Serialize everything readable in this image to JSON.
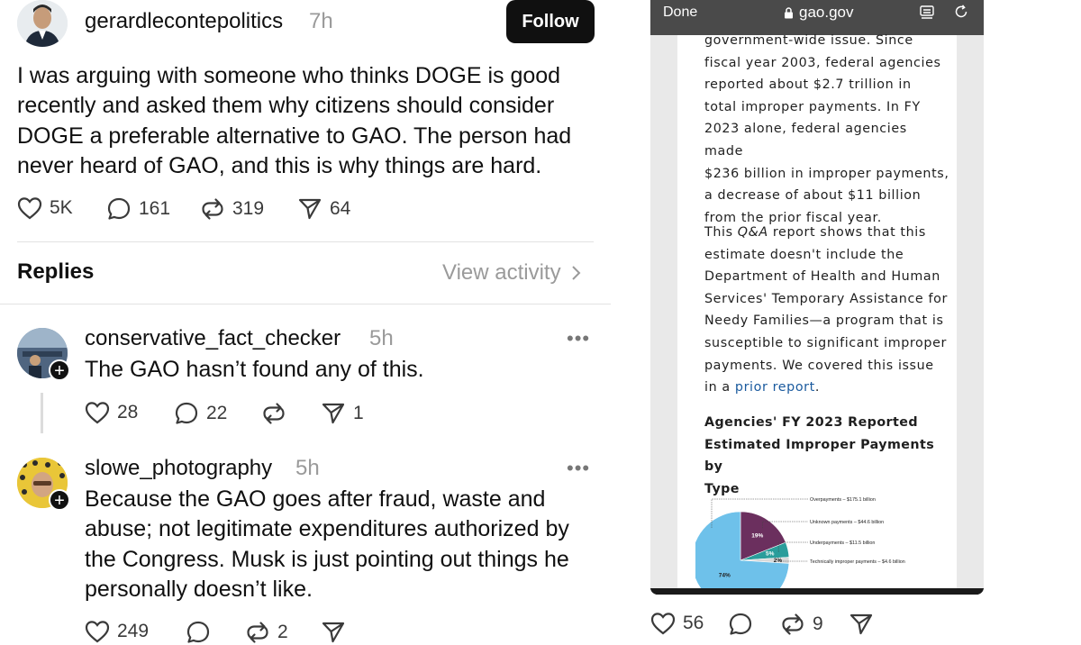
{
  "post": {
    "username": "gerardlecontepolitics",
    "time": "7h",
    "follow_label": "Follow",
    "text_lines": [
      "I was arguing with someone who thinks DOGE is good",
      "recently and asked them why citizens should consider",
      "DOGE a preferable alternative to GAO. The person had",
      "never heard of GAO, and this is why things are hard."
    ],
    "likes": "5K",
    "comments": "161",
    "reposts": "319",
    "shares": "64"
  },
  "replies_header": {
    "title": "Replies",
    "view_activity": "View activity"
  },
  "replies": [
    {
      "username": "conservative_fact_checker",
      "time": "5h",
      "more": "•••",
      "text_lines": [
        "The GAO hasn’t found any of this."
      ],
      "likes": "28",
      "comments": "22",
      "reposts": "",
      "shares": "1"
    },
    {
      "username": "slowe_photography",
      "time": "5h",
      "more": "•••",
      "text_lines": [
        "Because the GAO goes after fraud, waste and",
        "abuse; not legitimate expenditures authorized by",
        "the Congress.  Musk is just pointing out things he",
        "personally doesn’t like."
      ],
      "likes": "249",
      "comments": "",
      "reposts": "2",
      "shares": ""
    }
  ],
  "embedded_screenshot": {
    "done_label": "Done",
    "url": "gao.gov",
    "para1_lines": [
      "government-wide issue. Since",
      "fiscal year 2003, federal agencies",
      "reported about $2.7 trillion in",
      "total improper payments. In FY",
      "2023 alone, federal agencies made",
      "$236 billion in improper payments,",
      "a decrease of about $11 billion",
      "from the prior fiscal year."
    ],
    "para2_line1_prefix": "This ",
    "para2_line1_italic": "Q&A",
    "para2_line1_suffix": " report shows that this",
    "para2_lines": [
      "estimate doesn't include the",
      "Department of Health and Human",
      "Services' Temporary Assistance for",
      "Needy Families—a program that is",
      "susceptible to significant improper",
      "payments. We covered this issue"
    ],
    "para2_last_prefix": "in a ",
    "para2_last_link": "prior report",
    "para2_last_suffix": ".",
    "chart_heading_lines": [
      "Agencies' FY 2023 Reported",
      "Estimated Improper Payments by",
      "Type"
    ],
    "chart_data": {
      "type": "pie",
      "categories": [
        "Overpayments",
        "Unknown payments",
        "Underpayments",
        "Technically improper payments"
      ],
      "values": [
        74,
        19,
        5,
        2
      ],
      "value_labels": [
        "74%",
        "19%",
        "5%",
        "2%"
      ],
      "legend_labels": [
        "Overpayments – $175.1 billion",
        "Unknown payments – $44.6 billion",
        "Underpayments – $11.5 billion",
        "Technically improper payments – $4.6 billion"
      ],
      "colors": [
        "#6ec1ea",
        "#6b2f5e",
        "#2a9d9b",
        "#d9d9d9"
      ]
    },
    "likes": "56",
    "comments": "",
    "reposts": "9",
    "shares": ""
  }
}
